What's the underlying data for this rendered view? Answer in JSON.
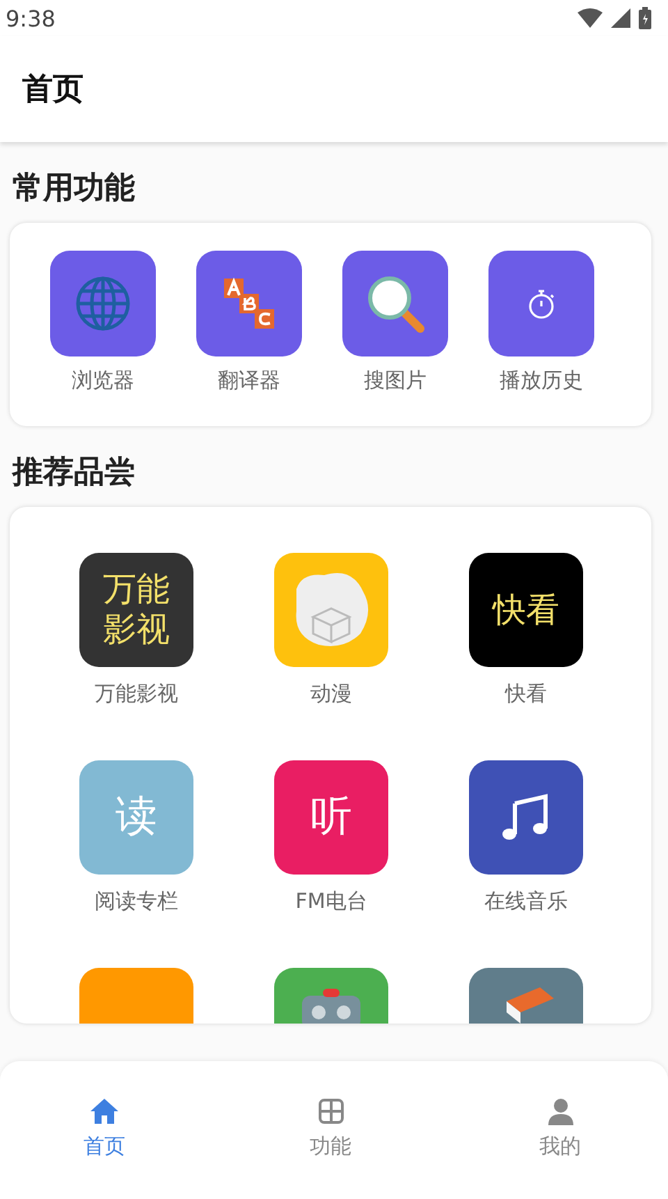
{
  "status_bar": {
    "time": "9:38"
  },
  "header": {
    "title": "首页"
  },
  "sections": [
    {
      "title": "常用功能",
      "kind": "tools",
      "items": [
        {
          "label": "浏览器"
        },
        {
          "label": "翻译器"
        },
        {
          "label": "搜图片"
        },
        {
          "label": "播放历史"
        }
      ]
    },
    {
      "title": "推荐品尝",
      "kind": "apps",
      "items": [
        {
          "label": "万能影视",
          "kind": "text",
          "tile_text": "万能影视",
          "color": "#333333"
        },
        {
          "label": "动漫",
          "kind": "art",
          "color": "#fec10d"
        },
        {
          "label": "快看",
          "kind": "text",
          "tile_text": "快看",
          "color": "#000000"
        },
        {
          "label": "阅读专栏",
          "kind": "text",
          "tile_text": "读",
          "color": "#82b9d3"
        },
        {
          "label": "FM电台",
          "kind": "text",
          "tile_text": "听",
          "color": "#e91e63"
        },
        {
          "label": "在线音乐",
          "kind": "art",
          "color": "#3f51b5"
        },
        {
          "kind": "art",
          "color": "#ff9800"
        },
        {
          "kind": "art",
          "color": "#4caf50"
        },
        {
          "kind": "art",
          "color": "#607d8b"
        }
      ]
    }
  ],
  "nav": [
    {
      "label": "首页",
      "selected": true
    },
    {
      "label": "功能",
      "selected": false
    },
    {
      "label": "我的",
      "selected": false
    }
  ]
}
